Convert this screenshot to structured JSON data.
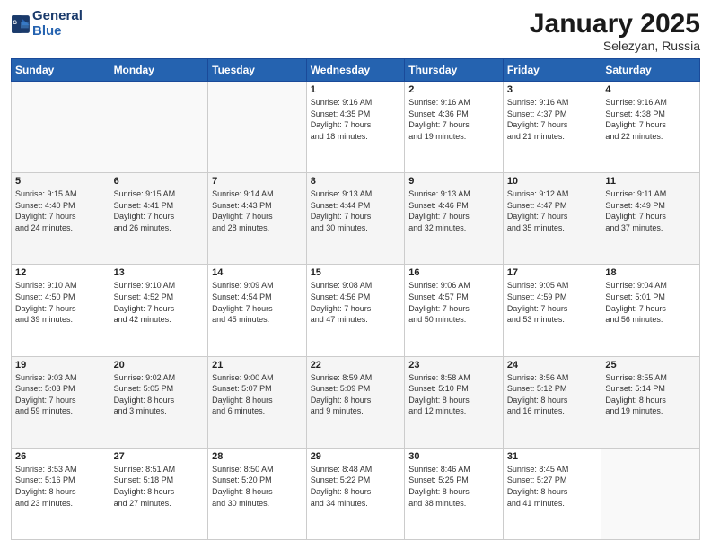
{
  "header": {
    "logo_line1": "General",
    "logo_line2": "Blue",
    "month": "January 2025",
    "location": "Selezyan, Russia"
  },
  "weekdays": [
    "Sunday",
    "Monday",
    "Tuesday",
    "Wednesday",
    "Thursday",
    "Friday",
    "Saturday"
  ],
  "weeks": [
    [
      {
        "day": "",
        "info": ""
      },
      {
        "day": "",
        "info": ""
      },
      {
        "day": "",
        "info": ""
      },
      {
        "day": "1",
        "info": "Sunrise: 9:16 AM\nSunset: 4:35 PM\nDaylight: 7 hours\nand 18 minutes."
      },
      {
        "day": "2",
        "info": "Sunrise: 9:16 AM\nSunset: 4:36 PM\nDaylight: 7 hours\nand 19 minutes."
      },
      {
        "day": "3",
        "info": "Sunrise: 9:16 AM\nSunset: 4:37 PM\nDaylight: 7 hours\nand 21 minutes."
      },
      {
        "day": "4",
        "info": "Sunrise: 9:16 AM\nSunset: 4:38 PM\nDaylight: 7 hours\nand 22 minutes."
      }
    ],
    [
      {
        "day": "5",
        "info": "Sunrise: 9:15 AM\nSunset: 4:40 PM\nDaylight: 7 hours\nand 24 minutes."
      },
      {
        "day": "6",
        "info": "Sunrise: 9:15 AM\nSunset: 4:41 PM\nDaylight: 7 hours\nand 26 minutes."
      },
      {
        "day": "7",
        "info": "Sunrise: 9:14 AM\nSunset: 4:43 PM\nDaylight: 7 hours\nand 28 minutes."
      },
      {
        "day": "8",
        "info": "Sunrise: 9:13 AM\nSunset: 4:44 PM\nDaylight: 7 hours\nand 30 minutes."
      },
      {
        "day": "9",
        "info": "Sunrise: 9:13 AM\nSunset: 4:46 PM\nDaylight: 7 hours\nand 32 minutes."
      },
      {
        "day": "10",
        "info": "Sunrise: 9:12 AM\nSunset: 4:47 PM\nDaylight: 7 hours\nand 35 minutes."
      },
      {
        "day": "11",
        "info": "Sunrise: 9:11 AM\nSunset: 4:49 PM\nDaylight: 7 hours\nand 37 minutes."
      }
    ],
    [
      {
        "day": "12",
        "info": "Sunrise: 9:10 AM\nSunset: 4:50 PM\nDaylight: 7 hours\nand 39 minutes."
      },
      {
        "day": "13",
        "info": "Sunrise: 9:10 AM\nSunset: 4:52 PM\nDaylight: 7 hours\nand 42 minutes."
      },
      {
        "day": "14",
        "info": "Sunrise: 9:09 AM\nSunset: 4:54 PM\nDaylight: 7 hours\nand 45 minutes."
      },
      {
        "day": "15",
        "info": "Sunrise: 9:08 AM\nSunset: 4:56 PM\nDaylight: 7 hours\nand 47 minutes."
      },
      {
        "day": "16",
        "info": "Sunrise: 9:06 AM\nSunset: 4:57 PM\nDaylight: 7 hours\nand 50 minutes."
      },
      {
        "day": "17",
        "info": "Sunrise: 9:05 AM\nSunset: 4:59 PM\nDaylight: 7 hours\nand 53 minutes."
      },
      {
        "day": "18",
        "info": "Sunrise: 9:04 AM\nSunset: 5:01 PM\nDaylight: 7 hours\nand 56 minutes."
      }
    ],
    [
      {
        "day": "19",
        "info": "Sunrise: 9:03 AM\nSunset: 5:03 PM\nDaylight: 7 hours\nand 59 minutes."
      },
      {
        "day": "20",
        "info": "Sunrise: 9:02 AM\nSunset: 5:05 PM\nDaylight: 8 hours\nand 3 minutes."
      },
      {
        "day": "21",
        "info": "Sunrise: 9:00 AM\nSunset: 5:07 PM\nDaylight: 8 hours\nand 6 minutes."
      },
      {
        "day": "22",
        "info": "Sunrise: 8:59 AM\nSunset: 5:09 PM\nDaylight: 8 hours\nand 9 minutes."
      },
      {
        "day": "23",
        "info": "Sunrise: 8:58 AM\nSunset: 5:10 PM\nDaylight: 8 hours\nand 12 minutes."
      },
      {
        "day": "24",
        "info": "Sunrise: 8:56 AM\nSunset: 5:12 PM\nDaylight: 8 hours\nand 16 minutes."
      },
      {
        "day": "25",
        "info": "Sunrise: 8:55 AM\nSunset: 5:14 PM\nDaylight: 8 hours\nand 19 minutes."
      }
    ],
    [
      {
        "day": "26",
        "info": "Sunrise: 8:53 AM\nSunset: 5:16 PM\nDaylight: 8 hours\nand 23 minutes."
      },
      {
        "day": "27",
        "info": "Sunrise: 8:51 AM\nSunset: 5:18 PM\nDaylight: 8 hours\nand 27 minutes."
      },
      {
        "day": "28",
        "info": "Sunrise: 8:50 AM\nSunset: 5:20 PM\nDaylight: 8 hours\nand 30 minutes."
      },
      {
        "day": "29",
        "info": "Sunrise: 8:48 AM\nSunset: 5:22 PM\nDaylight: 8 hours\nand 34 minutes."
      },
      {
        "day": "30",
        "info": "Sunrise: 8:46 AM\nSunset: 5:25 PM\nDaylight: 8 hours\nand 38 minutes."
      },
      {
        "day": "31",
        "info": "Sunrise: 8:45 AM\nSunset: 5:27 PM\nDaylight: 8 hours\nand 41 minutes."
      },
      {
        "day": "",
        "info": ""
      }
    ]
  ]
}
